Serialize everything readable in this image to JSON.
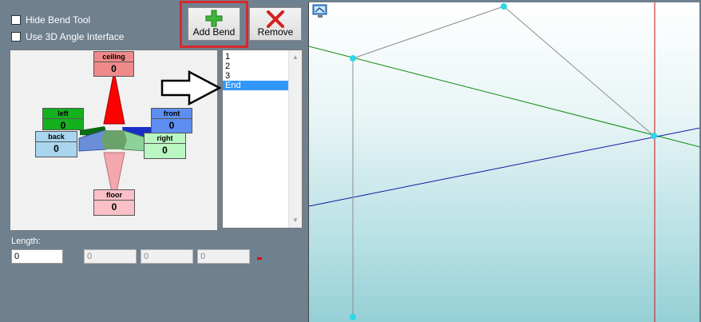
{
  "options": {
    "hide_bend_tool": {
      "label": "Hide Bend Tool",
      "checked": false
    },
    "use_3d_angle": {
      "label": "Use 3D Angle Interface",
      "checked": false
    }
  },
  "toolbar": {
    "add_bend_label": "Add Bend",
    "remove_label": "Remove"
  },
  "angle_controls": {
    "ceiling": {
      "label": "ceiling",
      "value": "0"
    },
    "left": {
      "label": "left",
      "value": "0"
    },
    "front": {
      "label": "front",
      "value": "0"
    },
    "back": {
      "label": "back",
      "value": "0"
    },
    "right": {
      "label": "right",
      "value": "0"
    },
    "floor": {
      "label": "floor",
      "value": "0"
    }
  },
  "bend_list": {
    "items": [
      "1",
      "2",
      "3",
      "End"
    ],
    "selected": "End"
  },
  "length": {
    "label": "Length:",
    "value": "0",
    "readonly_values": [
      "0",
      "0",
      "0"
    ]
  },
  "colors": {
    "highlight": "#d62a2a",
    "selection": "#3297fd",
    "panel_bg": "#6f808f"
  }
}
